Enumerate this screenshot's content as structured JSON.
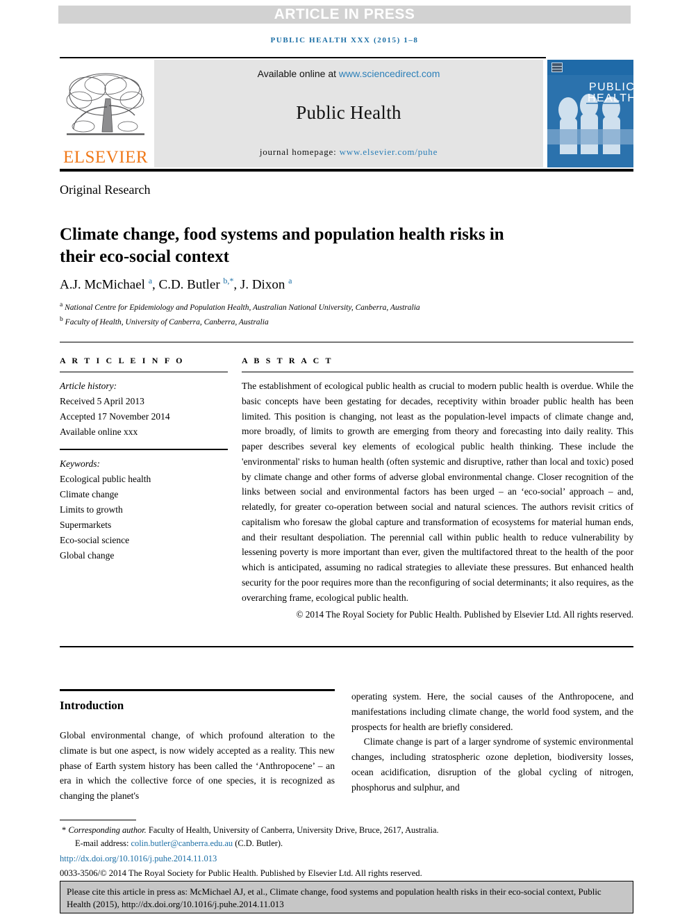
{
  "banner": {
    "article_in_press": "ARTICLE IN PRESS",
    "running_head": "PUBLIC HEALTH XXX (2015) 1–8"
  },
  "masthead": {
    "available_prefix": "Available online at ",
    "sciencedirect_url": "www.sciencedirect.com",
    "journal_name": "Public Health",
    "homepage_prefix": "journal homepage: ",
    "homepage_url": "www.elsevier.com/puhe",
    "publisher_wordmark": "ELSEVIER",
    "cover_title_line1": "PUBLIC",
    "cover_title_line2": "HEALTH"
  },
  "article": {
    "section_kind": "Original Research",
    "title": "Climate change, food systems and population health risks in their eco-social context",
    "authors_html": "A.J. McMichael <sup>a</sup>, C.D. Butler <sup>b,*</sup>, J. Dixon <sup>a</sup>",
    "affiliation_a": "National Centre for Epidemiology and Population Health, Australian National University, Canberra, Australia",
    "affiliation_b": "Faculty of Health, University of Canberra, Canberra, Australia"
  },
  "article_info": {
    "heading": "A R T I C L E   I N F O",
    "history_label": "Article history:",
    "received": "Received 5 April 2013",
    "accepted": "Accepted 17 November 2014",
    "available_online": "Available online xxx",
    "keywords_label": "Keywords:",
    "keywords": [
      "Ecological public health",
      "Climate change",
      "Limits to growth",
      "Supermarkets",
      "Eco-social science",
      "Global change"
    ]
  },
  "abstract": {
    "heading": "A B S T R A C T",
    "text": "The establishment of ecological public health as crucial to modern public health is overdue. While the basic concepts have been gestating for decades, receptivity within broader public health has been limited. This position is changing, not least as the population-level impacts of climate change and, more broadly, of limits to growth are emerging from theory and forecasting into daily reality. This paper describes several key elements of ecological public health thinking. These include the 'environmental' risks to human health (often systemic and disruptive, rather than local and toxic) posed by climate change and other forms of adverse global environmental change. Closer recognition of the links between social and environmental factors has been urged – an ‘eco-social’ approach – and, relatedly, for greater co-operation between social and natural sciences. The authors revisit critics of capitalism who foresaw the global capture and transformation of ecosystems for material human ends, and their resultant despoliation. The perennial call within public health to reduce vulnerability by lessening poverty is more important than ever, given the multifactored threat to the health of the poor which is anticipated, assuming no radical strategies to alleviate these pressures. But enhanced health security for the poor requires more than the reconfiguring of social determinants; it also requires, as the overarching frame, ecological public health.",
    "copyright": "© 2014 The Royal Society for Public Health. Published by Elsevier Ltd. All rights reserved."
  },
  "body": {
    "intro_heading": "Introduction",
    "left_para_1": "Global environmental change, of which profound alteration to the climate is but one aspect, is now widely accepted as a reality. This new phase of Earth system history has been called the ‘Anthropocene’ – an era in which the collective force of one species, it is recognized as changing the planet's",
    "right_para_1": "operating system. Here, the social causes of the Anthropocene, and manifestations including climate change, the world food system, and the prospects for health are briefly considered.",
    "right_para_2": "Climate change is part of a larger syndrome of systemic environmental changes, including stratospheric ozone depletion, biodiversity losses, ocean acidification, disruption of the global cycling of nitrogen, phosphorus and sulphur, and"
  },
  "footnotes": {
    "corresponding_marker": "*",
    "corresponding_label": "Corresponding author.",
    "corresponding_address": " Faculty of Health, University of Canberra, University Drive, Bruce, 2617, Australia.",
    "email_label": "E-mail address: ",
    "email_address": "colin.butler@canberra.edu.au",
    "email_suffix": " (C.D. Butler).",
    "doi": "http://dx.doi.org/10.1016/j.puhe.2014.11.013",
    "issn_line": "0033-3506/© 2014 The Royal Society for Public Health. Published by Elsevier Ltd. All rights reserved."
  },
  "cite_box": {
    "text": "Please cite this article in press as: McMichael AJ, et al., Climate change, food systems and population health risks in their eco-social context, Public Health (2015), http://dx.doi.org/10.1016/j.puhe.2014.11.013"
  },
  "colors": {
    "link_blue": "#1b6ea5",
    "elsevier_orange": "#f07818",
    "banner_gray": "#d2d2d2",
    "band_gray": "#e4e4e4",
    "cite_gray": "#c6c6c6",
    "cover_blue": "#2b72ad"
  }
}
